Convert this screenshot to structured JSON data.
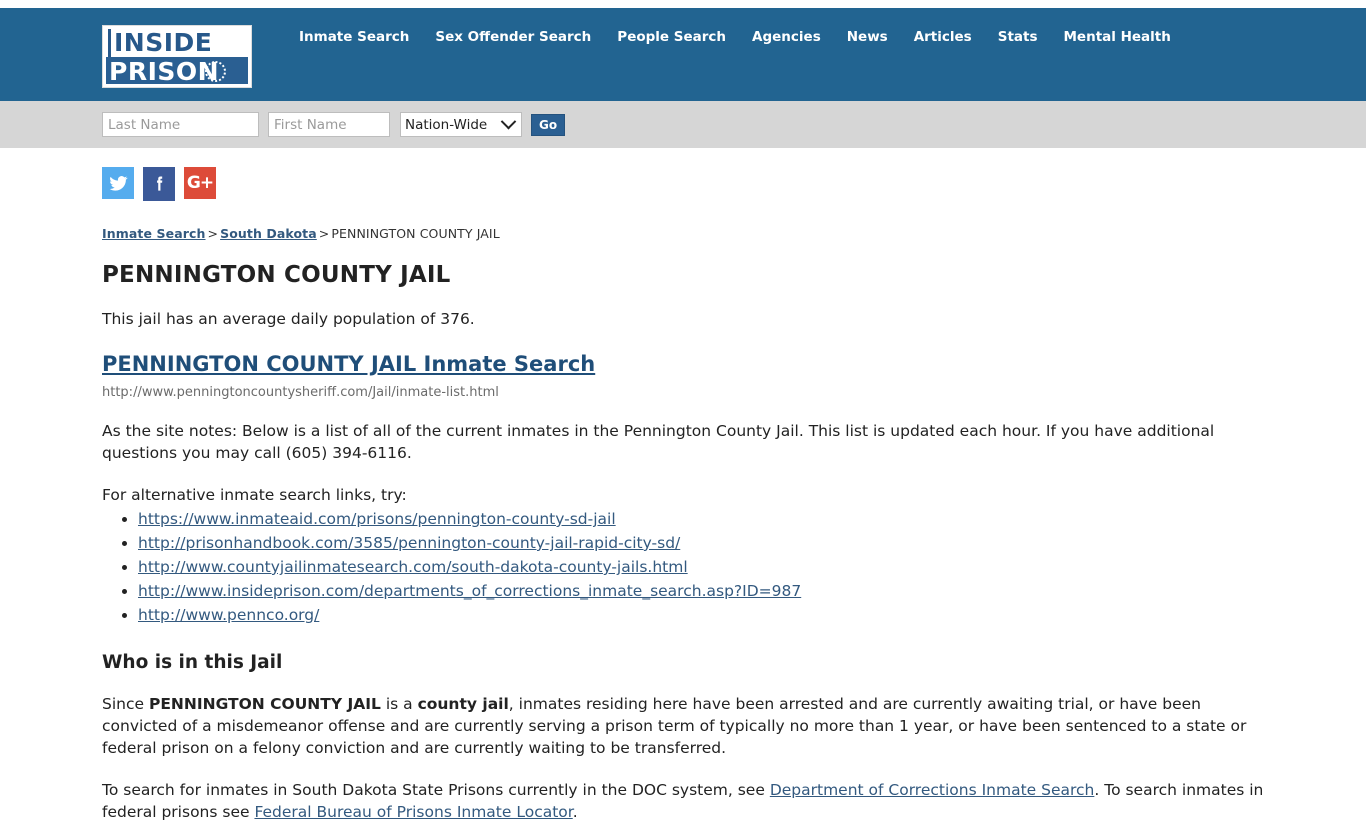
{
  "header": {
    "logo": {
      "line1": "INSIDE",
      "line2": "PRISON"
    },
    "nav": [
      {
        "label": "Inmate Search"
      },
      {
        "label": "Sex Offender Search"
      },
      {
        "label": "People Search"
      },
      {
        "label": "Agencies"
      },
      {
        "label": "News"
      },
      {
        "label": "Articles"
      },
      {
        "label": "Stats"
      },
      {
        "label": "Mental Health"
      }
    ],
    "brand_color": "#226491"
  },
  "search": {
    "last_name_placeholder": "Last Name",
    "last_name_value": "",
    "first_name_placeholder": "First Name",
    "first_name_value": "",
    "region_selected": "Nation-Wide",
    "go_label": "Go"
  },
  "social": [
    {
      "name": "twitter",
      "glyph": "🐦",
      "color": "#55acee"
    },
    {
      "name": "facebook",
      "glyph": "f",
      "color": "#3b5998"
    },
    {
      "name": "googleplus",
      "glyph": "G+",
      "color": "#dd4b39"
    }
  ],
  "breadcrumb": {
    "item1": "Inmate Search",
    "sep1": ">",
    "item2": "South Dakota",
    "sep2": ">",
    "current": "PENNINGTON COUNTY JAIL"
  },
  "main": {
    "title": "PENNINGTON COUNTY JAIL",
    "population_line": "This jail has an average daily population of 376.",
    "inmate_search_heading": "PENNINGTON COUNTY JAIL Inmate Search",
    "inmate_search_url": "http://www.penningtoncountysheriff.com/Jail/inmate-list.html",
    "site_notes": "As the site notes: Below is a list of all of the current inmates in the Pennington County Jail. This list is updated each hour. If you have additional questions you may call (605) 394-6116.",
    "alt_intro": "For alternative inmate search links, try:",
    "alt_links": [
      "https://www.inmateaid.com/prisons/pennington-county-sd-jail",
      "http://prisonhandbook.com/3585/pennington-county-jail-rapid-city-sd/",
      "http://www.countyjailinmatesearch.com/south-dakota-county-jails.html",
      "http://www.insideprison.com/departments_of_corrections_inmate_search.asp?ID=987",
      "http://www.pennco.org/"
    ],
    "who_heading": "Who is in this Jail",
    "who_p1_a": "Since ",
    "who_p1_b": "PENNINGTON COUNTY JAIL",
    "who_p1_c": " is a ",
    "who_p1_d": "county jail",
    "who_p1_e": ", inmates residing here have been arrested and are currently awaiting trial, or have been convicted of a misdemeanor offense and are currently serving a prison term of typically no more than 1 year, or have been sentenced to a state or federal prison on a felony conviction and are currently waiting to be transferred.",
    "doc_p_a": "To search for inmates in South Dakota State Prisons currently in the DOC system, see ",
    "doc_link": "Department of Corrections Inmate Search",
    "doc_p_b": ". To search inmates in federal prisons see ",
    "bop_link": "Federal Bureau of Prisons Inmate Locator",
    "doc_p_c": "."
  }
}
